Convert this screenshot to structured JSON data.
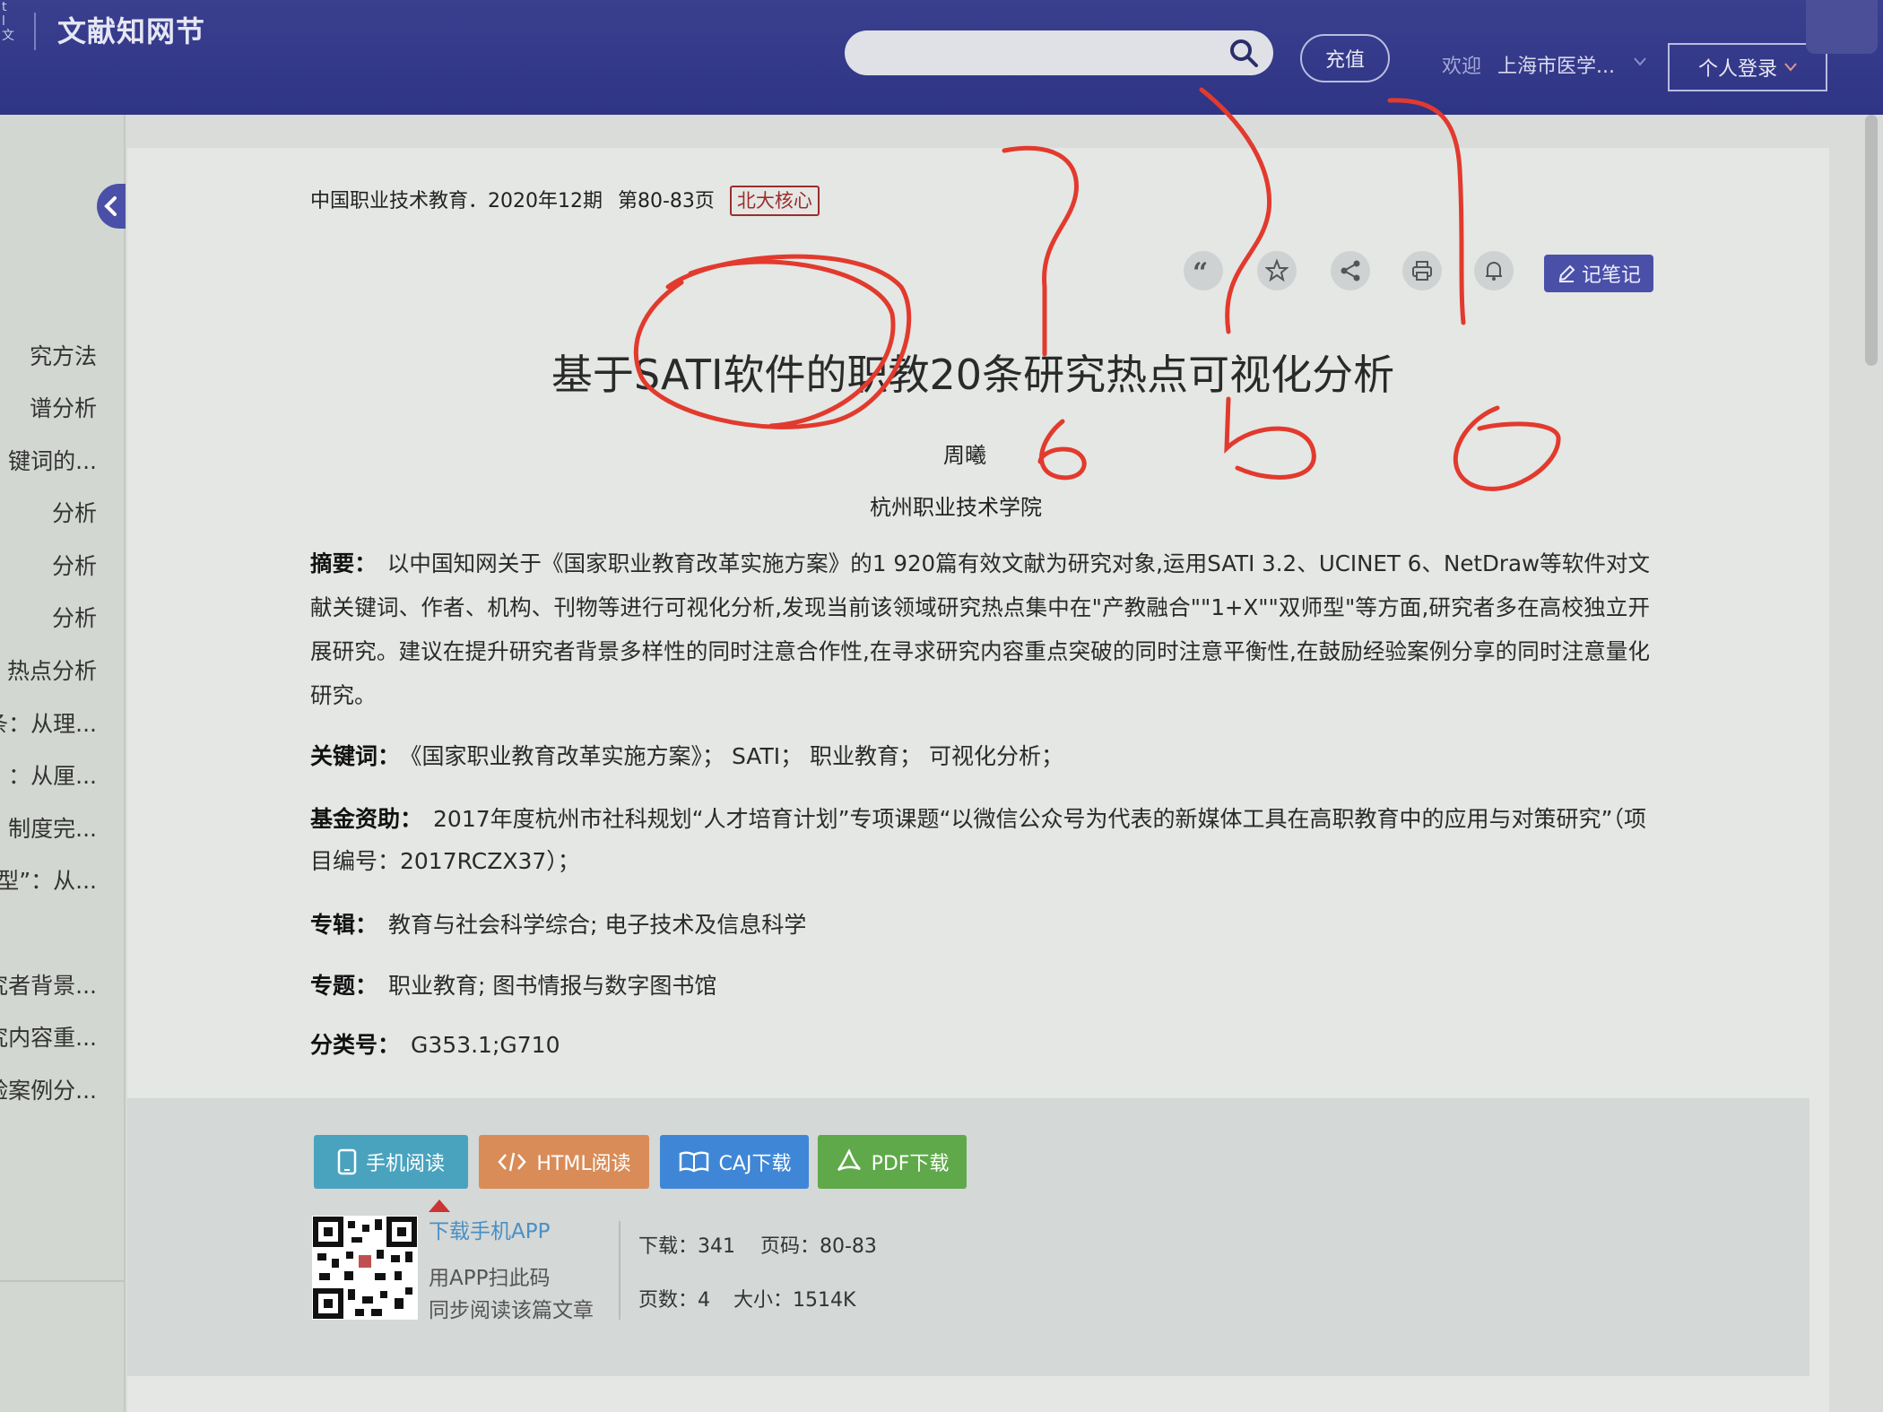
{
  "header": {
    "logo_glyphs": "t\nl\n文",
    "site_name": "文献知网节",
    "search_placeholder": "",
    "topup_label": "充值",
    "welcome_label": "欢迎",
    "institution": "上海市医学...",
    "login_label": "个人登录"
  },
  "sidebar": {
    "items": [
      "究方法",
      "谱分析",
      "键词的...",
      "分析",
      "分析",
      "分析",
      "热点分析",
      "条：从理...",
      "：从厘...",
      "制度完...",
      "型”：从...",
      "究者背景...",
      "究内容重...",
      "验案例分..."
    ]
  },
  "article": {
    "source": "中国职业技术教育．2020年12期",
    "pages": "第80-83页",
    "core_badge": "北大核心",
    "note_label": "记笔记",
    "title": "基于SATI软件的职教20条研究热点可视化分析",
    "author": "周曦",
    "affiliation": "杭州职业技术学院",
    "abstract_label": "摘要：",
    "abstract": "以中国知网关于《国家职业教育改革实施方案》的1 920篇有效文献为研究对象,运用SATI 3.2、UCINET 6、NetDraw等软件对文献关键词、作者、机构、刊物等进行可视化分析,发现当前该领域研究热点集中在\"产教融合\"\"1+X\"\"双师型\"等方面,研究者多在高校独立开展研究。建议在提升研究者背景多样性的同时注意合作性,在寻求研究内容重点突破的同时注意平衡性,在鼓励经验案例分享的同时注意量化研究。",
    "keywords_label": "关键词：",
    "keywords": "《国家职业教育改革实施方案》； SATI； 职业教育； 可视化分析；",
    "fund_label": "基金资助：",
    "fund": "2017年度杭州市社科规划“人才培育计划”专项课题“以微信公众号为代表的新媒体工具在高职教育中的应用与对策研究”（项目编号：2017RCZX37）；",
    "series_label": "专辑：",
    "series": "教育与社会科学综合; 电子技术及信息科学",
    "topic_label": "专题：",
    "topic": "职业教育; 图书情报与数字图书馆",
    "class_label": "分类号：",
    "class_no": "G353.1;G710"
  },
  "downloads": {
    "mobile": "手机阅读",
    "html": "HTML阅读",
    "caj": "CAJ下载",
    "pdf": "PDF下载"
  },
  "app": {
    "link": "下载手机APP",
    "hint1": "用APP扫此码",
    "hint2": "同步阅读该篇文章"
  },
  "stats": {
    "downloads": "下载：341",
    "page_range": "页码：80-83",
    "page_count": "页数：4",
    "size": "大小：1514K"
  },
  "colors": {
    "header": "#2f3485",
    "accent": "#4a50a8",
    "annotation": "#e23a2e"
  }
}
